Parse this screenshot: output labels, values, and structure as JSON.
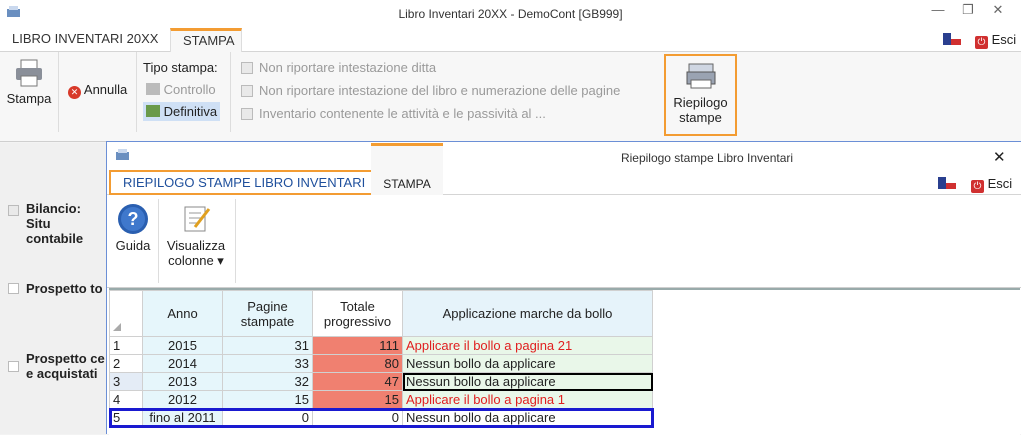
{
  "window": {
    "title": "Libro Inventari 20XX - DemoCont [GB999]",
    "btn_min": "—",
    "btn_restore": "❐",
    "btn_close": "✕"
  },
  "tabs": [
    {
      "label": "LIBRO INVENTARI 20XX"
    },
    {
      "label": "STAMPA"
    }
  ],
  "exit_label": "Esci",
  "ribbon": {
    "print_label": "Stampa",
    "cancel_label": "Annulla",
    "tipo_label": "Tipo stampa:",
    "controllo_label": "Controllo",
    "definitiva_label": "Definitiva",
    "opt1": "Non riportare intestazione ditta",
    "opt2": "Non riportare intestazione del libro e numerazione delle pagine",
    "opt3": "Inventario contenente le attività e le passività al ...",
    "riepilogo_label_1": "Riepilogo",
    "riepilogo_label_2": "stampe"
  },
  "left_panel": {
    "item1_a": "Bilancio: Situ",
    "item1_b": "contabile",
    "item2": "Prospetto to",
    "item3_a": "Prospetto ce",
    "item3_b": "e acquistati"
  },
  "dialog": {
    "title": "Riepilogo stampe Libro Inventari",
    "close": "✕",
    "tab1": "RIEPILOGO STAMPE LIBRO INVENTARI",
    "tab2": "STAMPA",
    "exit_label": "Esci",
    "guida_label": "Guida",
    "visualizza_1": "Visualizza",
    "visualizza_2": "colonne ▾"
  },
  "table": {
    "headers": [
      "Anno",
      "Pagine\nstampate",
      "Totale\nprogressivo",
      "Applicazione marche da bollo"
    ],
    "rows": [
      {
        "n": "1",
        "anno": "2015",
        "pagine": "31",
        "totale": "111",
        "app": "Applicare il bollo a pagina  21",
        "red": true
      },
      {
        "n": "2",
        "anno": "2014",
        "pagine": "33",
        "totale": "80",
        "app": "Nessun bollo da applicare",
        "red": false
      },
      {
        "n": "3",
        "anno": "2013",
        "pagine": "32",
        "totale": "47",
        "app": "Nessun bollo da applicare",
        "red": false
      },
      {
        "n": "4",
        "anno": "2012",
        "pagine": "15",
        "totale": "15",
        "app": "Applicare il bollo a pagina  1",
        "red": true
      },
      {
        "n": "5",
        "anno": "fino al 2011",
        "pagine": "0",
        "totale": "0",
        "app": "Nessun bollo da applicare",
        "red": false
      }
    ]
  },
  "colors": {
    "accent": "#f39c32",
    "highlight_blue": "#1a1ad0",
    "total_red": "#f08070",
    "text_red": "#e02020"
  }
}
